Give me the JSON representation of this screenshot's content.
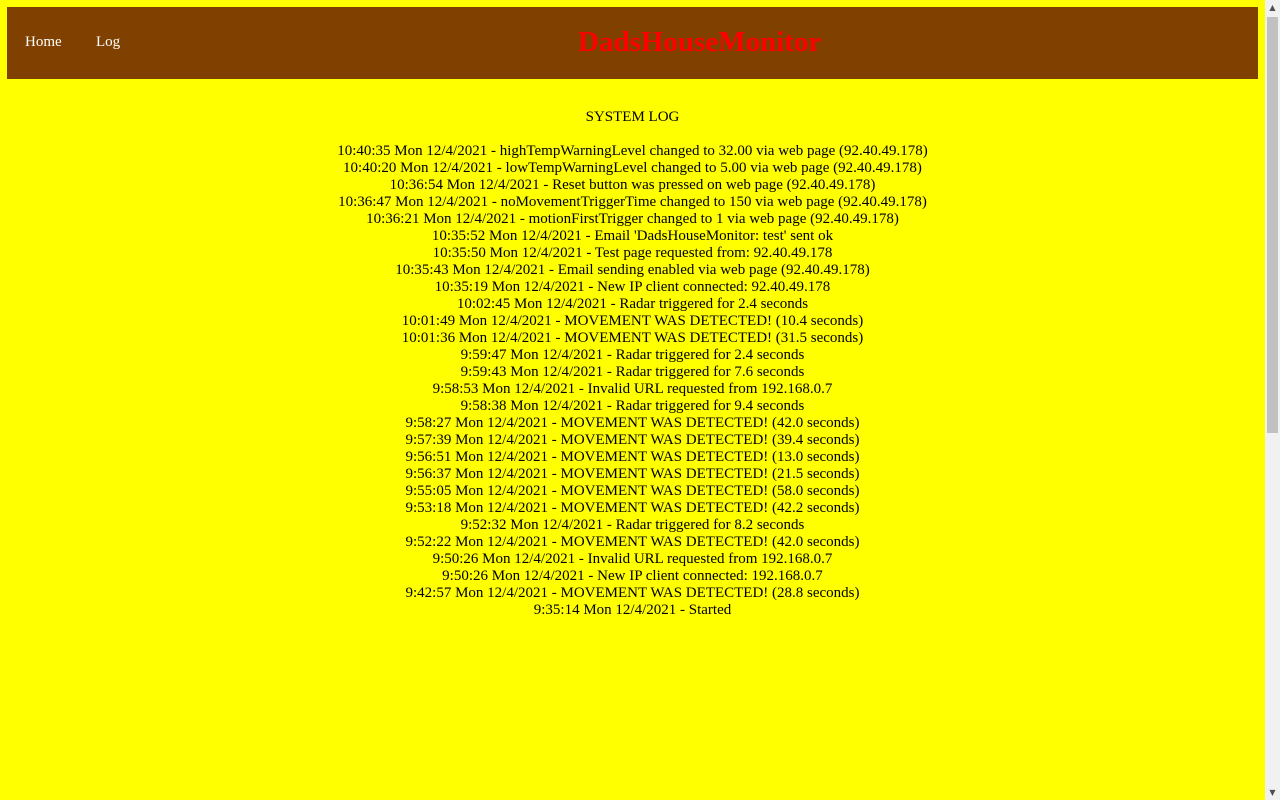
{
  "nav": {
    "home_label": "Home",
    "log_label": "Log"
  },
  "site_title": "DadsHouseMonitor",
  "log": {
    "title": "SYSTEM LOG",
    "entries": [
      "10:40:35 Mon 12/4/2021 - highTempWarningLevel changed to 32.00 via web page (92.40.49.178)",
      "10:40:20 Mon 12/4/2021 - lowTempWarningLevel changed to 5.00 via web page (92.40.49.178)",
      "10:36:54 Mon 12/4/2021 - Reset button was pressed on web page (92.40.49.178)",
      "10:36:47 Mon 12/4/2021 - noMovementTriggerTime changed to 150 via web page (92.40.49.178)",
      "10:36:21 Mon 12/4/2021 - motionFirstTrigger changed to 1 via web page (92.40.49.178)",
      "10:35:52 Mon 12/4/2021 - Email 'DadsHouseMonitor: test' sent ok",
      "10:35:50 Mon 12/4/2021 - Test page requested from: 92.40.49.178",
      "10:35:43 Mon 12/4/2021 - Email sending enabled via web page (92.40.49.178)",
      "10:35:19 Mon 12/4/2021 - New IP client connected: 92.40.49.178",
      "10:02:45 Mon 12/4/2021 - Radar triggered for 2.4 seconds",
      "10:01:49 Mon 12/4/2021 - MOVEMENT WAS DETECTED! (10.4 seconds)",
      "10:01:36 Mon 12/4/2021 - MOVEMENT WAS DETECTED! (31.5 seconds)",
      "9:59:47 Mon 12/4/2021 - Radar triggered for 2.4 seconds",
      "9:59:43 Mon 12/4/2021 - Radar triggered for 7.6 seconds",
      "9:58:53 Mon 12/4/2021 - Invalid URL requested from 192.168.0.7",
      "9:58:38 Mon 12/4/2021 - Radar triggered for 9.4 seconds",
      "9:58:27 Mon 12/4/2021 - MOVEMENT WAS DETECTED! (42.0 seconds)",
      "9:57:39 Mon 12/4/2021 - MOVEMENT WAS DETECTED! (39.4 seconds)",
      "9:56:51 Mon 12/4/2021 - MOVEMENT WAS DETECTED! (13.0 seconds)",
      "9:56:37 Mon 12/4/2021 - MOVEMENT WAS DETECTED! (21.5 seconds)",
      "9:55:05 Mon 12/4/2021 - MOVEMENT WAS DETECTED! (58.0 seconds)",
      "9:53:18 Mon 12/4/2021 - MOVEMENT WAS DETECTED! (42.2 seconds)",
      "9:52:32 Mon 12/4/2021 - Radar triggered for 8.2 seconds",
      "9:52:22 Mon 12/4/2021 - MOVEMENT WAS DETECTED! (42.0 seconds)",
      "9:50:26 Mon 12/4/2021 - Invalid URL requested from 192.168.0.7",
      "9:50:26 Mon 12/4/2021 - New IP client connected: 192.168.0.7",
      "9:42:57 Mon 12/4/2021 - MOVEMENT WAS DETECTED! (28.8 seconds)",
      "9:35:14 Mon 12/4/2021 - Started"
    ]
  },
  "scrollbar": {
    "up_icon": "chevron-up-icon",
    "down_icon": "chevron-down-icon",
    "up_glyph": "▲",
    "down_glyph": "▼"
  },
  "colors": {
    "page_background": "#ffff00",
    "navbar_background": "#804000",
    "nav_link": "#ffffff",
    "title": "#ff0000",
    "text": "#000000"
  }
}
